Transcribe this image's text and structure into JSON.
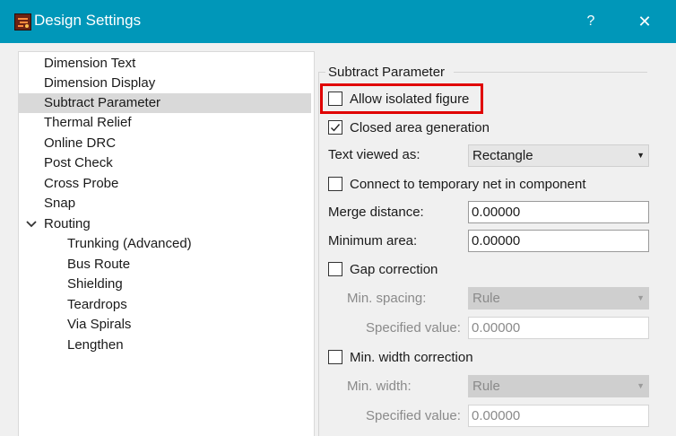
{
  "window": {
    "title": "Design Settings",
    "help_label": "?",
    "close_label": "✕"
  },
  "tree": {
    "items": [
      {
        "label": "Dimension Text"
      },
      {
        "label": "Dimension Display"
      },
      {
        "label": "Subtract Parameter",
        "selected": true
      },
      {
        "label": "Thermal Relief"
      },
      {
        "label": "Online DRC"
      },
      {
        "label": "Post Check"
      },
      {
        "label": "Cross Probe"
      },
      {
        "label": "Snap"
      },
      {
        "label": "Routing",
        "expanded": true
      },
      {
        "label": "Trunking (Advanced)"
      },
      {
        "label": "Bus Route"
      },
      {
        "label": "Shielding"
      },
      {
        "label": "Teardrops"
      },
      {
        "label": "Via Spirals"
      },
      {
        "label": "Lengthen"
      }
    ]
  },
  "panel": {
    "group_title": "Subtract Parameter",
    "allow_isolated": {
      "label": "Allow isolated figure",
      "checked": false
    },
    "closed_area": {
      "label": "Closed area generation",
      "checked": true
    },
    "text_viewed": {
      "label": "Text viewed as:",
      "value": "Rectangle"
    },
    "connect_temp": {
      "label": "Connect to temporary net in component",
      "checked": false
    },
    "merge_distance": {
      "label": "Merge distance:",
      "value": "0.00000"
    },
    "minimum_area": {
      "label": "Minimum area:",
      "value": "0.00000"
    },
    "gap_correction": {
      "label": "Gap correction",
      "checked": false
    },
    "min_spacing": {
      "label": "Min. spacing:",
      "value": "Rule"
    },
    "gap_specified": {
      "label": "Specified value:",
      "value": "0.00000"
    },
    "min_width_correction": {
      "label": "Min. width correction",
      "checked": false
    },
    "min_width": {
      "label": "Min. width:",
      "value": "Rule"
    },
    "width_specified": {
      "label": "Specified value:",
      "value": "0.00000"
    }
  },
  "colors": {
    "titlebar": "#0097b9",
    "highlight": "#e00000",
    "selected_row": "#d9d9d9"
  }
}
